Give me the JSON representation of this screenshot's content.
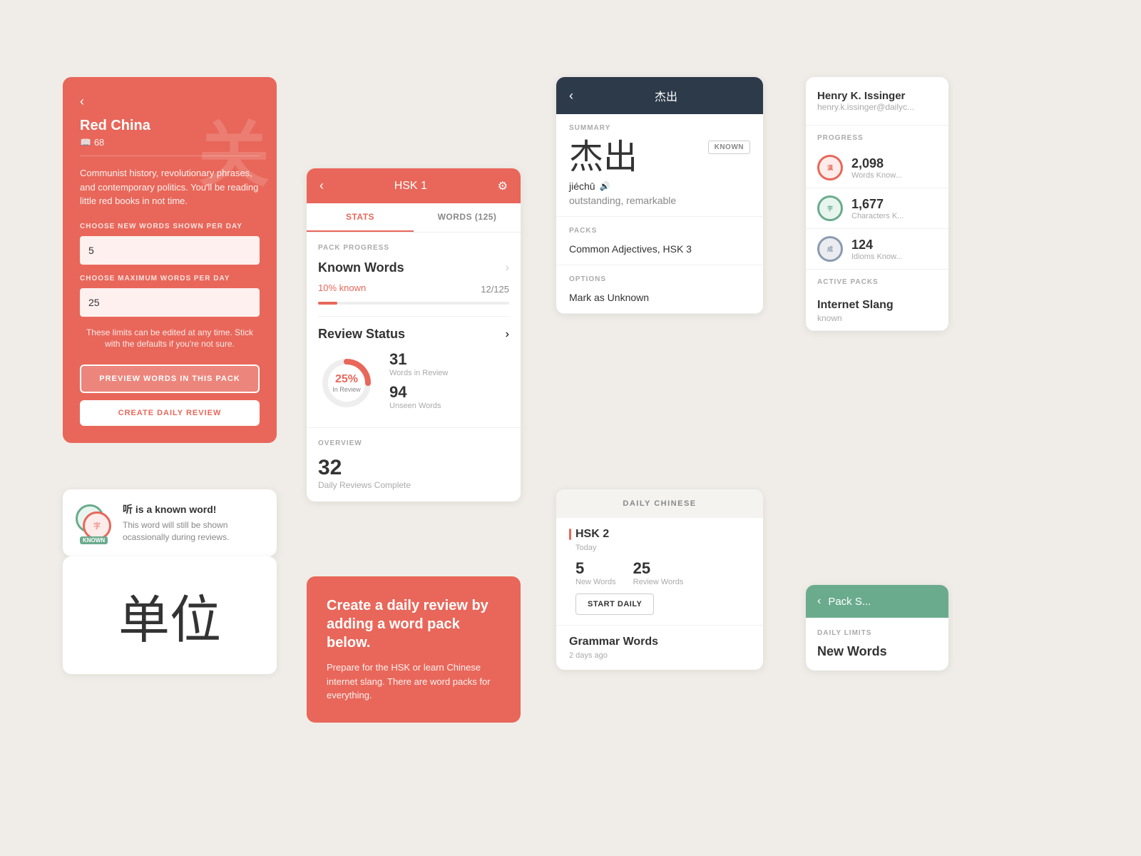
{
  "panel_red_china": {
    "back_label": "‹",
    "title": "Red China",
    "subtitle_icon": "📖",
    "subtitle_count": "68",
    "description": "Communist history, revolutionary phrases, and contemporary politics. You'll be reading little red books in not time.",
    "new_words_label": "CHOOSE NEW WORDS SHOWN PER DAY",
    "new_words_value": "5",
    "max_words_label": "CHOOSE MAXIMUM WORDS PER DAY",
    "max_words_value": "25",
    "hint": "These limits can be edited at any time. Stick with the defaults if you're not sure.",
    "preview_btn": "PREVIEW WORDS IN THIS PACK",
    "create_btn": "CREATE DAILY REVIEW",
    "watermark": "关"
  },
  "panel_known": {
    "char": "听",
    "message": "听 is a known word!",
    "sub": "This word will still be shown ocassionally during reviews.",
    "badge": "KNOWN"
  },
  "panel_character": {
    "char": "单位"
  },
  "panel_hsk": {
    "back": "‹",
    "title": "HSK 1",
    "gear": "⚙",
    "tabs": [
      "STATS",
      "WORDS (125)"
    ],
    "active_tab": 0,
    "pack_progress_label": "PACK PROGRESS",
    "known_words_label": "Known Words",
    "known_pct": "10%",
    "known_text": "known",
    "known_count": "12/125",
    "review_status_label": "Review Status",
    "review_pct": 25,
    "review_pct_text": "25%",
    "in_review_text": "In Review",
    "words_in_review_num": "31",
    "words_in_review_lbl": "Words in Review",
    "unseen_num": "94",
    "unseen_lbl": "Unseen Words",
    "overview_label": "OVERVIEW",
    "daily_reviews_num": "32",
    "daily_reviews_lbl": "Daily Reviews Complete"
  },
  "panel_create": {
    "heading": "Create a daily review by adding a word pack below.",
    "body": "Prepare for the HSK or learn Chinese internet slang. There are word packs for everything."
  },
  "panel_detail": {
    "back": "‹",
    "header_char": "杰出",
    "summary_label": "SUMMARY",
    "char": "杰出",
    "known_tag": "KNOWN",
    "pinyin": "jiéchū",
    "meaning": "outstanding, remarkable",
    "packs_label": "PACKS",
    "packs_val": "Common Adjectives, HSK 3",
    "options_label": "OPTIONS",
    "option_1": "Mark as Unknown"
  },
  "panel_daily": {
    "header": "DAILY CHINESE",
    "hsk2_title": "HSK 2",
    "hsk2_sub": "Today",
    "new_words_num": "5",
    "new_words_lbl": "New Words",
    "review_words_num": "25",
    "review_words_lbl": "Review Words",
    "start_btn": "START DAILY",
    "grammar_title": "Grammar Words",
    "grammar_sub": "2 days ago"
  },
  "panel_sidebar": {
    "user_name": "Henry K. Issinger",
    "user_email": "henry.k.issinger@dailyc...",
    "progress_label": "PROGRESS",
    "stat1_num": "2,098",
    "stat1_lbl": "Words Know...",
    "stat2_num": "1,677",
    "stat2_lbl": "Characters K...",
    "stat3_num": "124",
    "stat3_lbl": "Idioms Know...",
    "active_packs_label": "ACTIVE PACKS",
    "pack1_name": "Internet Slang",
    "pack1_status": "known"
  },
  "panel_pack_s": {
    "back": "‹",
    "title": "Pack S...",
    "limits_label": "DAILY LIMITS",
    "new_words_label": "New Words"
  }
}
